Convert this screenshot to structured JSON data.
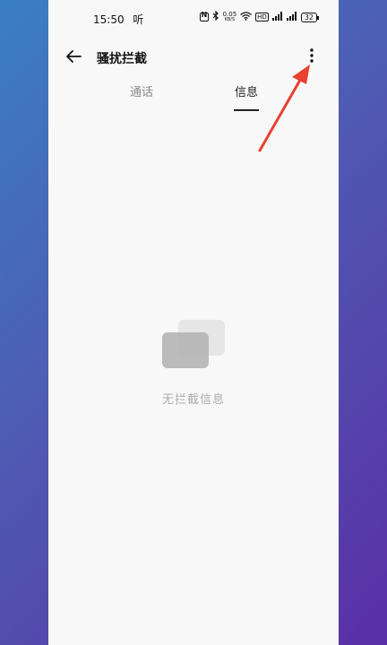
{
  "status_bar": {
    "time": "15:50",
    "time_suffix": "听",
    "network_speed_value": "0.05",
    "network_speed_unit": "KB/S",
    "hd_label": "HD",
    "battery": "32"
  },
  "header": {
    "title": "骚扰拦截"
  },
  "tabs": [
    {
      "label": "通话",
      "active": false
    },
    {
      "label": "信息",
      "active": true
    }
  ],
  "empty_state": {
    "text": "无拦截信息"
  },
  "colors": {
    "annotation_arrow": "#e8412f",
    "page_bg": "#f8f8f8"
  }
}
